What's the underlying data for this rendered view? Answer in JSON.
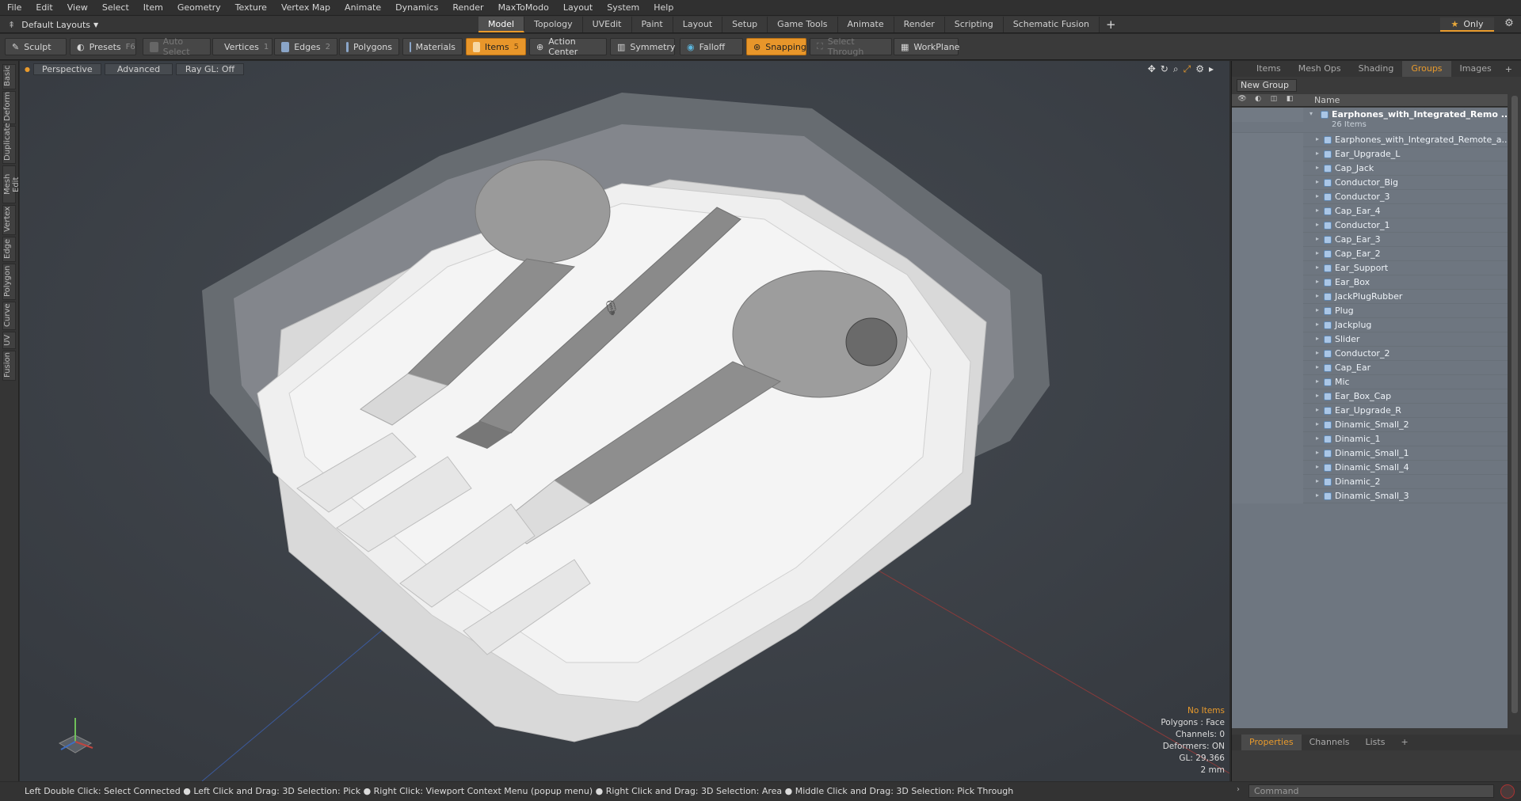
{
  "menu": [
    "File",
    "Edit",
    "View",
    "Select",
    "Item",
    "Geometry",
    "Texture",
    "Vertex Map",
    "Animate",
    "Dynamics",
    "Render",
    "MaxToModo",
    "Layout",
    "System",
    "Help"
  ],
  "layout_selector": "Default Layouts",
  "mode_tabs": [
    {
      "label": "Model",
      "active": true
    },
    {
      "label": "Topology",
      "active": false
    },
    {
      "label": "UVEdit",
      "active": false
    },
    {
      "label": "Paint",
      "active": false
    },
    {
      "label": "Layout",
      "active": false
    },
    {
      "label": "Setup",
      "active": false
    },
    {
      "label": "Game Tools",
      "active": false
    },
    {
      "label": "Animate",
      "active": false
    },
    {
      "label": "Render",
      "active": false
    },
    {
      "label": "Scripting",
      "active": false
    },
    {
      "label": "Schematic Fusion",
      "active": false
    }
  ],
  "add_tab_label": "+",
  "only_button": {
    "label": "Only",
    "icon": "star-icon"
  },
  "toolbar": {
    "sculpt": "Sculpt",
    "presets": "Presets",
    "presets_key": "F6",
    "auto_select": "Auto Select",
    "vertices": "Vertices",
    "vertices_key": "1",
    "edges": "Edges",
    "edges_key": "2",
    "polygons": "Polygons",
    "materials": "Materials",
    "items": "Items",
    "items_key": "5",
    "action_center": "Action Center",
    "symmetry": "Symmetry",
    "falloff": "Falloff",
    "snapping": "Snapping",
    "select_through": "Select Through",
    "workplane": "WorkPlane"
  },
  "left_tabs": [
    "Basic",
    "Deform",
    "Duplicate",
    "Mesh Edit",
    "Vertex",
    "Edge",
    "Polygon",
    "Curve",
    "UV",
    "Fusion"
  ],
  "viewport": {
    "view_mode": "Perspective",
    "shading": "Advanced",
    "raygl": "Ray GL: Off",
    "status": {
      "selection": "No Items",
      "polygons": "Polygons : Face",
      "channels": "Channels: 0",
      "deformers": "Deformers: ON",
      "gl": "GL: 29,366",
      "scale": "2 mm"
    }
  },
  "right_panel": {
    "tabs": [
      {
        "label": "Items",
        "active": false
      },
      {
        "label": "Mesh Ops",
        "active": false
      },
      {
        "label": "Shading",
        "active": false
      },
      {
        "label": "Groups",
        "active": true
      },
      {
        "label": "Images",
        "active": false
      }
    ],
    "add_tab_label": "+",
    "new_group": "New Group",
    "name_header": "Name",
    "group": {
      "name": "Earphones_with_Integrated_Remo ...",
      "count": "26 Items"
    },
    "items": [
      "Earphones_with_Integrated_Remote_a...",
      "Ear_Upgrade_L",
      "Cap_Jack",
      "Conductor_Big",
      "Conductor_3",
      "Cap_Ear_4",
      "Conductor_1",
      "Cap_Ear_3",
      "Cap_Ear_2",
      "Ear_Support",
      "Ear_Box",
      "JackPlugRubber",
      "Plug",
      "Jackplug",
      "Slider",
      "Conductor_2",
      "Cap_Ear",
      "Mic",
      "Ear_Box_Cap",
      "Ear_Upgrade_R",
      "Dinamic_Small_2",
      "Dinamic_1",
      "Dinamic_Small_1",
      "Dinamic_Small_4",
      "Dinamic_2",
      "Dinamic_Small_3"
    ],
    "bottom_tabs": [
      {
        "label": "Properties",
        "active": true
      },
      {
        "label": "Channels",
        "active": false
      },
      {
        "label": "Lists",
        "active": false
      }
    ]
  },
  "statusbar": "Left Double Click: Select Connected ● Left Click and Drag: 3D Selection: Pick ● Right Click: Viewport Context Menu (popup menu) ● Right Click and Drag: 3D Selection: Area ● Middle Click and Drag: 3D Selection: Pick Through",
  "command_placeholder": "Command",
  "colors": {
    "accent": "#e89a2c",
    "viewport_bg": "#3c4147",
    "list_bg": "#6e7680"
  }
}
